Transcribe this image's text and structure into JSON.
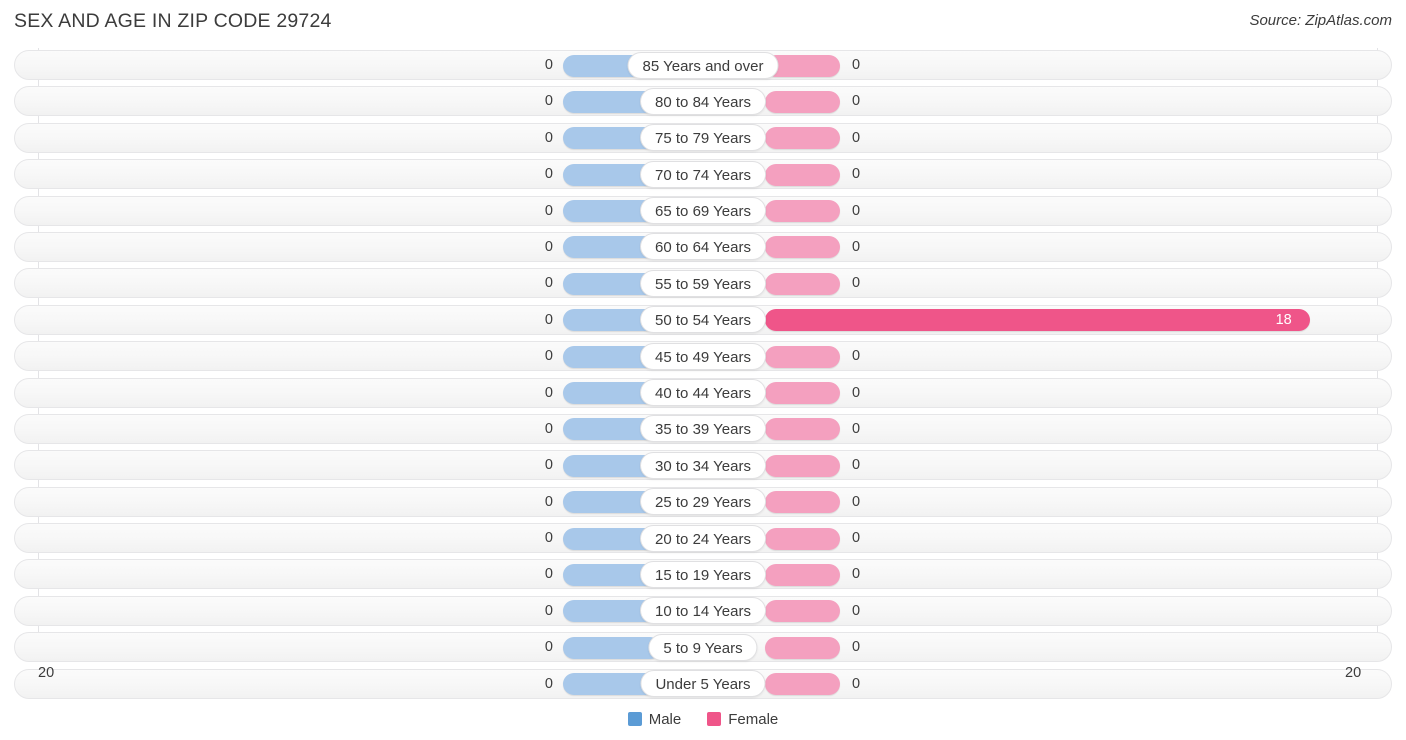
{
  "header": {
    "title": "SEX AND AGE IN ZIP CODE 29724",
    "source": "Source: ZipAtlas.com"
  },
  "axis": {
    "left_tick": "20",
    "right_tick": "20"
  },
  "legend": {
    "items": [
      {
        "label": "Male",
        "color": "#5b9bd5"
      },
      {
        "label": "Female",
        "color": "#ef5589"
      }
    ]
  },
  "colors": {
    "male_bar": "#a8c8ea",
    "female_bar": "#f4a0bf",
    "female_highlight": "#ef5589",
    "male_legend": "#5b9bd5",
    "female_legend": "#ef5589"
  },
  "chart_data": {
    "type": "bar",
    "subtype": "population-pyramid",
    "title": "SEX AND AGE IN ZIP CODE 29724",
    "xlabel": "",
    "ylabel": "",
    "xlim": [
      20,
      20
    ],
    "axis_max": 20,
    "grid": true,
    "legend_position": "bottom-center",
    "categories": [
      "85 Years and over",
      "80 to 84 Years",
      "75 to 79 Years",
      "70 to 74 Years",
      "65 to 69 Years",
      "60 to 64 Years",
      "55 to 59 Years",
      "50 to 54 Years",
      "45 to 49 Years",
      "40 to 44 Years",
      "35 to 39 Years",
      "30 to 34 Years",
      "25 to 29 Years",
      "20 to 24 Years",
      "15 to 19 Years",
      "10 to 14 Years",
      "5 to 9 Years",
      "Under 5 Years"
    ],
    "series": [
      {
        "name": "Male",
        "values": [
          0,
          0,
          0,
          0,
          0,
          0,
          0,
          0,
          0,
          0,
          0,
          0,
          0,
          0,
          0,
          0,
          0,
          0
        ]
      },
      {
        "name": "Female",
        "values": [
          0,
          0,
          0,
          0,
          0,
          0,
          0,
          18,
          0,
          0,
          0,
          0,
          0,
          0,
          0,
          0,
          0,
          0
        ]
      }
    ]
  },
  "rows": [
    {
      "age": "85 Years and over",
      "male": "0",
      "female": "0"
    },
    {
      "age": "80 to 84 Years",
      "male": "0",
      "female": "0"
    },
    {
      "age": "75 to 79 Years",
      "male": "0",
      "female": "0"
    },
    {
      "age": "70 to 74 Years",
      "male": "0",
      "female": "0"
    },
    {
      "age": "65 to 69 Years",
      "male": "0",
      "female": "0"
    },
    {
      "age": "60 to 64 Years",
      "male": "0",
      "female": "0"
    },
    {
      "age": "55 to 59 Years",
      "male": "0",
      "female": "0"
    },
    {
      "age": "50 to 54 Years",
      "male": "0",
      "female": "18"
    },
    {
      "age": "45 to 49 Years",
      "male": "0",
      "female": "0"
    },
    {
      "age": "40 to 44 Years",
      "male": "0",
      "female": "0"
    },
    {
      "age": "35 to 39 Years",
      "male": "0",
      "female": "0"
    },
    {
      "age": "30 to 34 Years",
      "male": "0",
      "female": "0"
    },
    {
      "age": "25 to 29 Years",
      "male": "0",
      "female": "0"
    },
    {
      "age": "20 to 24 Years",
      "male": "0",
      "female": "0"
    },
    {
      "age": "15 to 19 Years",
      "male": "0",
      "female": "0"
    },
    {
      "age": "10 to 14 Years",
      "male": "0",
      "female": "0"
    },
    {
      "age": "5 to 9 Years",
      "male": "0",
      "female": "0"
    },
    {
      "age": "Under 5 Years",
      "male": "0",
      "female": "0"
    }
  ]
}
